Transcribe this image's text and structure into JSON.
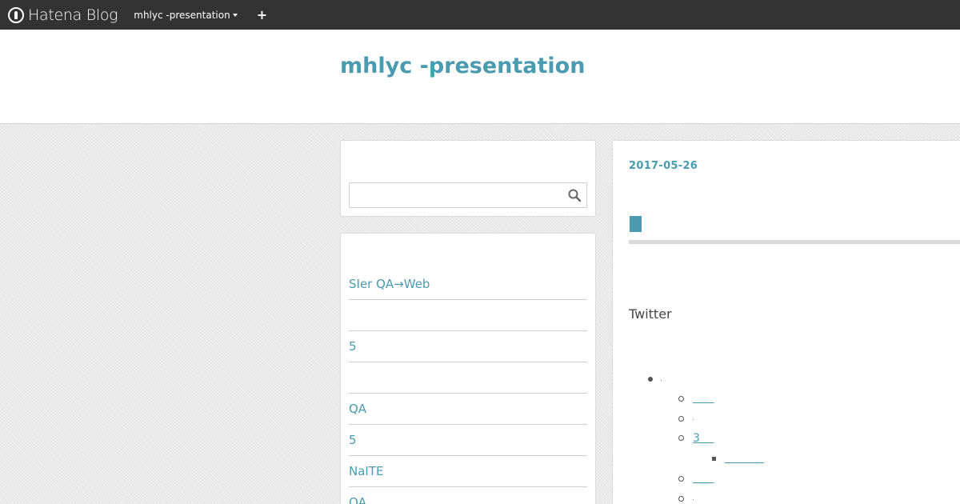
{
  "globalbar": {
    "brand": "Hatena Blog",
    "blog_menu": "mhlyc -presentation",
    "add_label": "+"
  },
  "header": {
    "title": "mhlyc -presentation"
  },
  "search": {
    "placeholder": ""
  },
  "sidebar": {
    "items": [
      "SIer QA→Web",
      "",
      "5",
      "",
      "QA",
      "5",
      "NaITE",
      "QA"
    ]
  },
  "article": {
    "date": "2017-05-26",
    "twitter_label": "Twitter",
    "toc": {
      "item1_mark": ".",
      "sub1": "      ",
      "sub2_mark": ".",
      "sub3": "3    ",
      "subsub1": "           ",
      "sub4": "      ",
      "sub5_mark": "."
    }
  },
  "colors": {
    "accent": "#4a9bb0",
    "globalbar": "#333333",
    "background": "#e9e9e9"
  }
}
